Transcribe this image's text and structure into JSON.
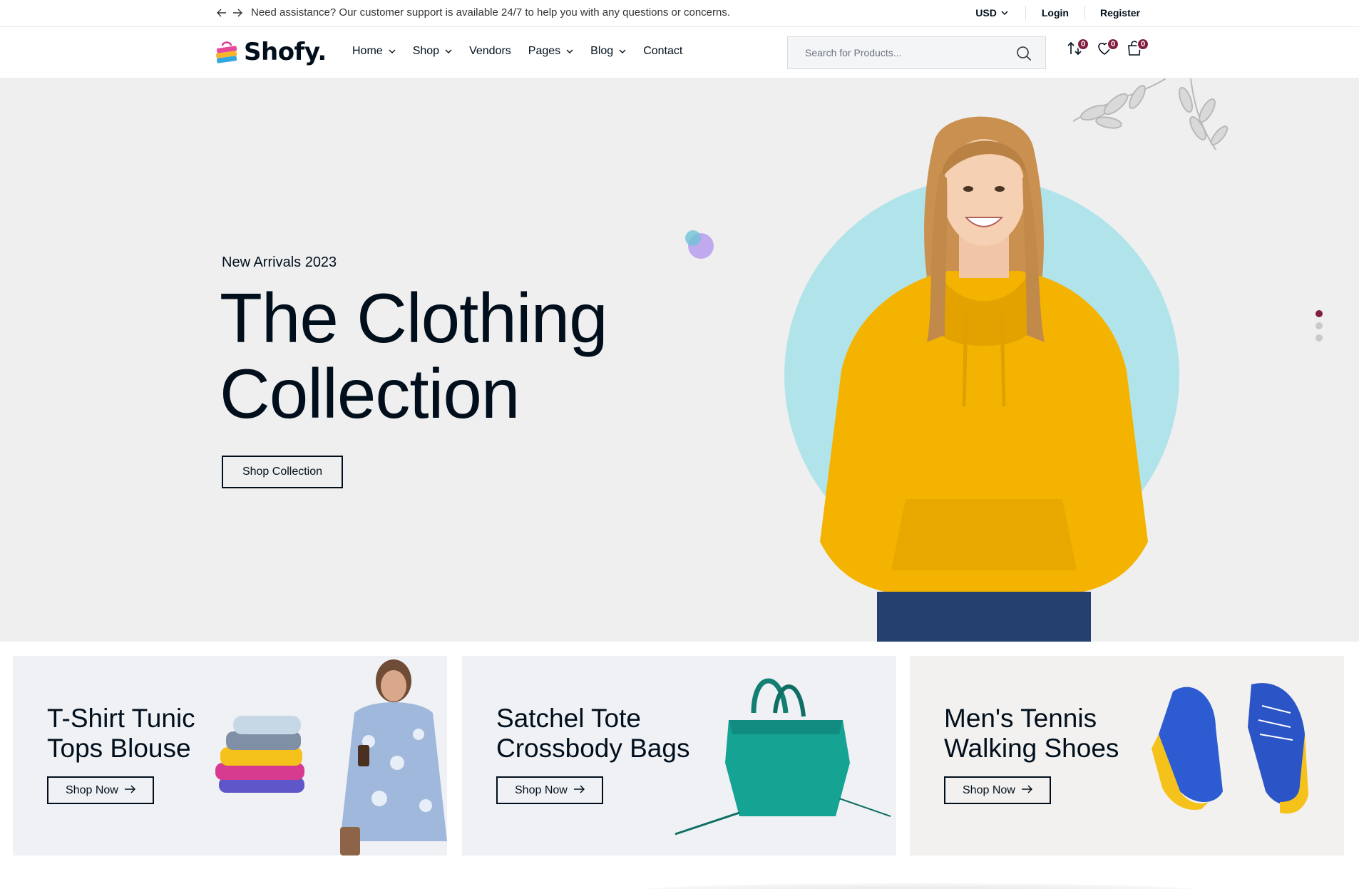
{
  "topbar": {
    "notice": "Need assistance? Our customer support is available 24/7 to help you with any questions or concerns.",
    "currency": "USD",
    "login": "Login",
    "register": "Register"
  },
  "header": {
    "logo": "Shofy.",
    "nav": [
      {
        "label": "Home",
        "dropdown": true
      },
      {
        "label": "Shop",
        "dropdown": true
      },
      {
        "label": "Vendors",
        "dropdown": false
      },
      {
        "label": "Pages",
        "dropdown": true
      },
      {
        "label": "Blog",
        "dropdown": true
      },
      {
        "label": "Contact",
        "dropdown": false
      }
    ],
    "search_placeholder": "Search for Products...",
    "compare_count": "0",
    "wishlist_count": "0",
    "cart_count": "0"
  },
  "hero": {
    "eyebrow": "New Arrivals 2023",
    "title_line1": "The Clothing",
    "title_line2": "Collection",
    "cta": "Shop Collection",
    "slides": 3,
    "active_slide": 1
  },
  "banners": [
    {
      "line1": "T-Shirt Tunic",
      "line2": "Tops Blouse",
      "button": "Shop Now"
    },
    {
      "line1": "Satchel Tote",
      "line2": "Crossbody Bags",
      "button": "Shop Now"
    },
    {
      "line1": "Men's Tennis",
      "line2": "Walking Shoes",
      "button": "Shop Now"
    }
  ],
  "colors": {
    "accent": "#821f40",
    "text": "#010f1c",
    "hero_bg": "#efefef",
    "hero_circle": "#b0e3ea",
    "hoodie": "#f5b301"
  }
}
